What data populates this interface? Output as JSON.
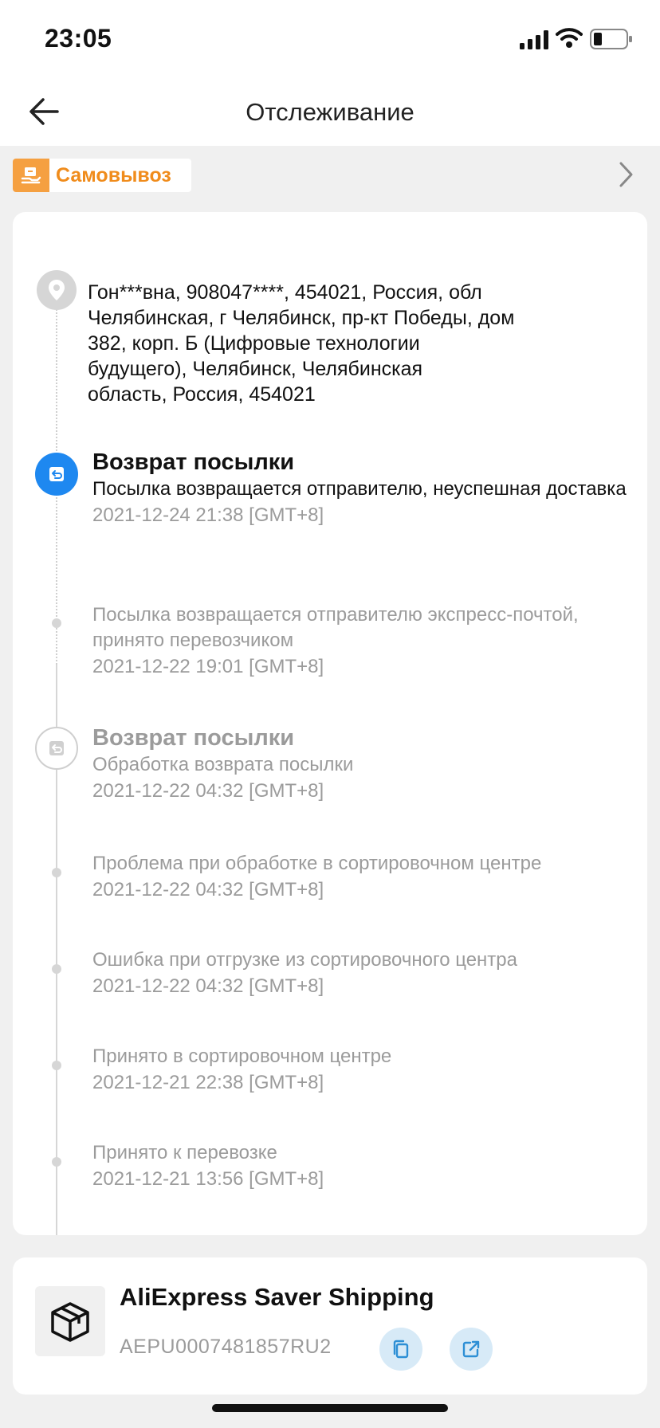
{
  "status_bar": {
    "time": "23:05"
  },
  "nav": {
    "title": "Отслеживание"
  },
  "pickup": {
    "label": "Самовывоз"
  },
  "address": {
    "text": "Гон***вна,  908047****,  454021,  Россия, обл\nЧелябинская, г Челябинск, пр-кт Победы, дом\n382, корп. Б (Цифровые технологии\nбудущего),  Челябинск,  Челябинская\nобласть,  Россия,  454021"
  },
  "events": [
    {
      "title": "Возврат посылки",
      "desc": "Посылка возвращается отправителю, неуспешная доставка",
      "time": "2021-12-24 21:38 [GMT+8]"
    },
    {
      "desc": "Посылка возвращается отправителю экспресс-почтой, принято перевозчиком",
      "time": "2021-12-22 19:01 [GMT+8]"
    },
    {
      "title": "Возврат посылки",
      "desc": "Обработка возврата посылки",
      "time": "2021-12-22 04:32 [GMT+8]"
    },
    {
      "desc": "Проблема при обработке в сортировочном центре",
      "time": "2021-12-22 04:32 [GMT+8]"
    },
    {
      "desc": "Ошибка при отгрузке из сортировочного центра",
      "time": "2021-12-22 04:32 [GMT+8]"
    },
    {
      "desc": "Принято в сортировочном центре",
      "time": "2021-12-21 22:38 [GMT+8]"
    },
    {
      "desc": "Принято к перевозке",
      "time": "2021-12-21 13:56 [GMT+8]"
    }
  ],
  "shipping": {
    "carrier": "AliExpress Saver Shipping",
    "tracking_number": "AEPU0007481857RU2"
  },
  "icons": {
    "back": "arrow-left-icon",
    "pickup": "pickup-icon",
    "chevron": "chevron-right-icon",
    "location": "location-pin-icon",
    "return": "return-icon",
    "box": "package-icon",
    "copy": "copy-icon",
    "open": "external-link-icon"
  },
  "colors": {
    "accent_blue": "#1e88f0",
    "pickup_orange": "#f08c1c",
    "muted_text": "#9b9b9b",
    "button_bg": "#d7eaf7"
  }
}
